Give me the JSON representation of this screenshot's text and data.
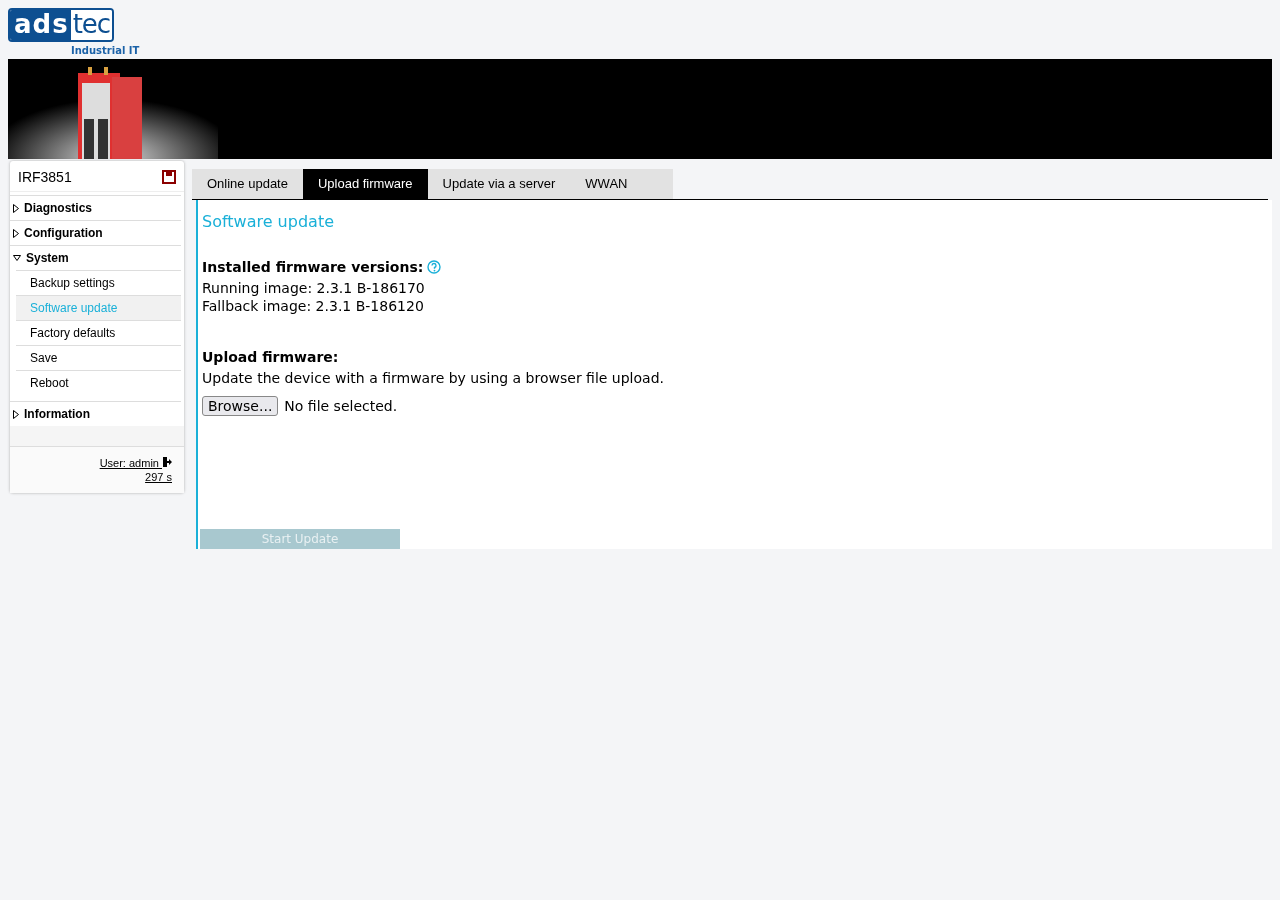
{
  "logo": {
    "part_1": "ads",
    "part_2": "tec",
    "tagline": "Industrial IT"
  },
  "sidebar": {
    "device": "IRF3851",
    "items": [
      {
        "label": "Diagnostics",
        "expanded": false
      },
      {
        "label": "Configuration",
        "expanded": false
      },
      {
        "label": "System",
        "expanded": true,
        "children": [
          {
            "label": "Backup settings",
            "selected": false
          },
          {
            "label": "Software update",
            "selected": true
          },
          {
            "label": "Factory defaults",
            "selected": false
          },
          {
            "label": "Save",
            "selected": false
          },
          {
            "label": "Reboot",
            "selected": false
          }
        ]
      },
      {
        "label": "Information",
        "expanded": false
      }
    ],
    "user": "User: admin",
    "timer": "297 s"
  },
  "tabs": [
    {
      "label": "Online update",
      "selected": false
    },
    {
      "label": "Upload firmware",
      "selected": true
    },
    {
      "label": "Update via a server",
      "selected": false
    },
    {
      "label": "WWAN",
      "selected": false
    }
  ],
  "content": {
    "title": "Software update",
    "installed_heading": "Installed firmware versions:",
    "running": "Running image: 2.3.1 B-186170",
    "fallback": "Fallback image: 2.3.1 B-186120",
    "upload_heading": "Upload firmware:",
    "upload_text": "Update the device with a firmware by using a browser file upload.",
    "browse_button": "Browse...",
    "file_status": "No file selected.",
    "start_button": {
      "label": "Start Update",
      "disabled": true
    }
  }
}
